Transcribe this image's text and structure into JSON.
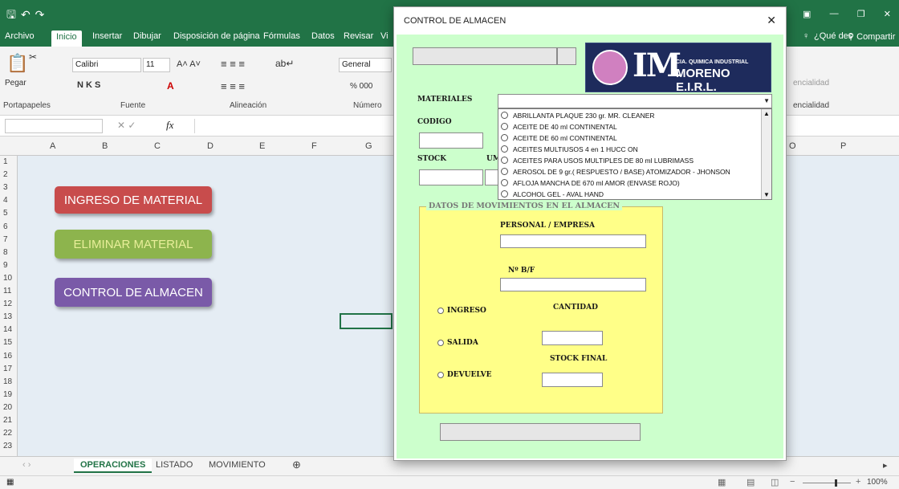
{
  "excel": {
    "tabs": [
      "Archivo",
      "Inicio",
      "Insertar",
      "Dibujar",
      "Disposición de página",
      "Fórmulas",
      "Datos",
      "Revisar",
      "Vi"
    ],
    "active_tab": "Inicio",
    "right_tabs": [
      "¿Qué des",
      "Compartir"
    ],
    "font_name": "Calibri",
    "font_size": "11",
    "number_format": "General",
    "ribbon_groups": [
      "Portapapeles",
      "Fuente",
      "Alineación",
      "Número",
      "encialidad"
    ],
    "ribbon_frag": "encialidad",
    "paste_label": "Pegar",
    "bold_label": "N  K  S",
    "pct_label": "% 000",
    "columns": [
      "A",
      "B",
      "C",
      "D",
      "E",
      "F",
      "G",
      "O",
      "P"
    ],
    "rows": [
      "1",
      "2",
      "3",
      "4",
      "5",
      "6",
      "7",
      "8",
      "9",
      "10",
      "11",
      "12",
      "13",
      "14",
      "15",
      "16",
      "17",
      "18",
      "19",
      "20",
      "21",
      "22",
      "23"
    ],
    "fx": "fx",
    "sheets": [
      "OPERACIONES",
      "LISTADO",
      "MOVIMIENTO"
    ],
    "active_sheet": "OPERACIONES",
    "zoom": "100",
    "buttons": {
      "ingreso": "INGRESO DE MATERIAL",
      "eliminar": "ELIMINAR MATERIAL",
      "control": "CONTROL DE ALMACEN"
    },
    "colors": {
      "green": "#217346",
      "btn_red": "#c84c4c",
      "btn_green": "#8db44d",
      "btn_purple": "#7a5aa8"
    }
  },
  "dialog": {
    "title": "CONTROL DE ALMACEN",
    "logo_line1": "CIA. QUIMICA INDUSTRIAL",
    "logo_line2": "MORENO E.I.R.L.",
    "logo_mark": "IM",
    "labels": {
      "materiales": "MATERIALES",
      "codigo": "CODIGO",
      "stock": "STOCK",
      "um": "UM",
      "personal": "PERSONAL / EMPRESA",
      "nbf": "Nº B/F",
      "cantidad": "CANTIDAD",
      "stock_final": "STOCK FINAL"
    },
    "frame_title": "DATOS DE MOVIMIENTOS EN EL ALMACEN",
    "options": [
      "INGRESO",
      "SALIDA",
      "DEVUELVE"
    ],
    "materials": [
      "ABRILLANTA PLAQUE  230 gr.  MR. CLEANER",
      "ACEITE DE 40 ml CONTINENTAL",
      "ACEITE DE 60 ml CONTINENTAL",
      "ACEITES MULTIUSOS 4 en 1  HUCC ON",
      "ACEITES PARA USOS MULTIPLES DE 80 ml  LUBRIMASS",
      "AEROSOL DE 9 gr.( RESPUESTO / BASE) ATOMIZADOR - JHONSON",
      "AFLOJA MANCHA DE 670 ml AMOR (ENVASE ROJO)",
      "ALCOHOL GEL   - AVAL HAND"
    ],
    "colors": {
      "body": "#ccffcc",
      "frame": "#ffff88",
      "logo_bg": "#1e2b5c"
    }
  }
}
